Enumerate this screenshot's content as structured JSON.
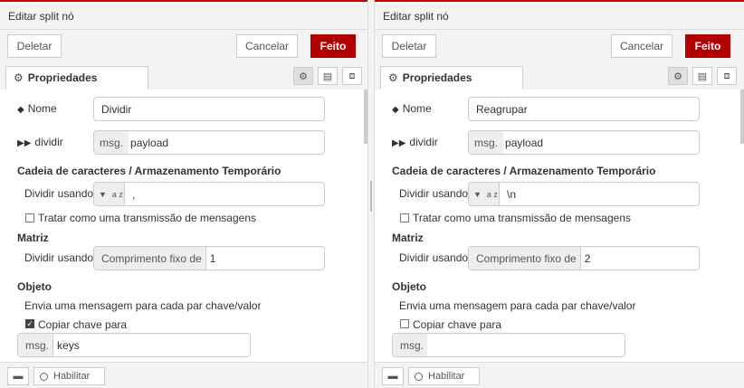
{
  "panels": [
    {
      "title": "Editar split nó",
      "buttons": {
        "delete": "Deletar",
        "cancel": "Cancelar",
        "done": "Feito"
      },
      "tab": "Propriedades",
      "name": {
        "label": "Nome",
        "value": "Dividir"
      },
      "split": {
        "label": "dividir",
        "prefix": "msg.",
        "value": "payload"
      },
      "string_section": "Cadeia de caracteres / Armazenamento Temporário",
      "string_split": {
        "label": "Dividir usando",
        "type_glyph": "a z",
        "value": ","
      },
      "stream_checkbox": {
        "label": "Tratar como uma transmissão de mensagens",
        "checked": false
      },
      "array_section": "Matriz",
      "array_split": {
        "label": "Dividir usando",
        "prefix": "Comprimento fixo de",
        "value": "1"
      },
      "object_section": "Objeto",
      "object_desc": "Envia uma mensagem para cada par chave/valor",
      "copy_key": {
        "label": "Copiar chave para",
        "checked": true
      },
      "key_field": {
        "prefix": "msg.",
        "value": "keys"
      },
      "footer": {
        "enable": "Habilitar"
      }
    },
    {
      "title": "Editar split nó",
      "buttons": {
        "delete": "Deletar",
        "cancel": "Cancelar",
        "done": "Feito"
      },
      "tab": "Propriedades",
      "name": {
        "label": "Nome",
        "value": "Reagrupar"
      },
      "split": {
        "label": "dividir",
        "prefix": "msg.",
        "value": "payload"
      },
      "string_section": "Cadeia de caracteres / Armazenamento Temporário",
      "string_split": {
        "label": "Dividir usando",
        "type_glyph": "a z",
        "value": "\\n"
      },
      "stream_checkbox": {
        "label": "Tratar como uma transmissão de mensagens",
        "checked": false
      },
      "array_section": "Matriz",
      "array_split": {
        "label": "Dividir usando",
        "prefix": "Comprimento fixo de",
        "value": "2"
      },
      "object_section": "Objeto",
      "object_desc": "Envia uma mensagem para cada par chave/valor",
      "copy_key": {
        "label": "Copiar chave para",
        "checked": false
      },
      "key_field": {
        "prefix": "msg.",
        "value": ""
      },
      "footer": {
        "enable": "Habilitar"
      }
    }
  ],
  "icons": {
    "tab": "gear-icon",
    "settings": "gear-icon",
    "description": "document-icon",
    "appearance": "layout-icon",
    "name": "tag-icon",
    "split": "fast-forward-icon",
    "footer_docs": "book-icon",
    "enable": "circle-icon"
  },
  "colors": {
    "accent": "#b30000",
    "header_bg": "#f3f3f3",
    "border": "#cccccc"
  }
}
